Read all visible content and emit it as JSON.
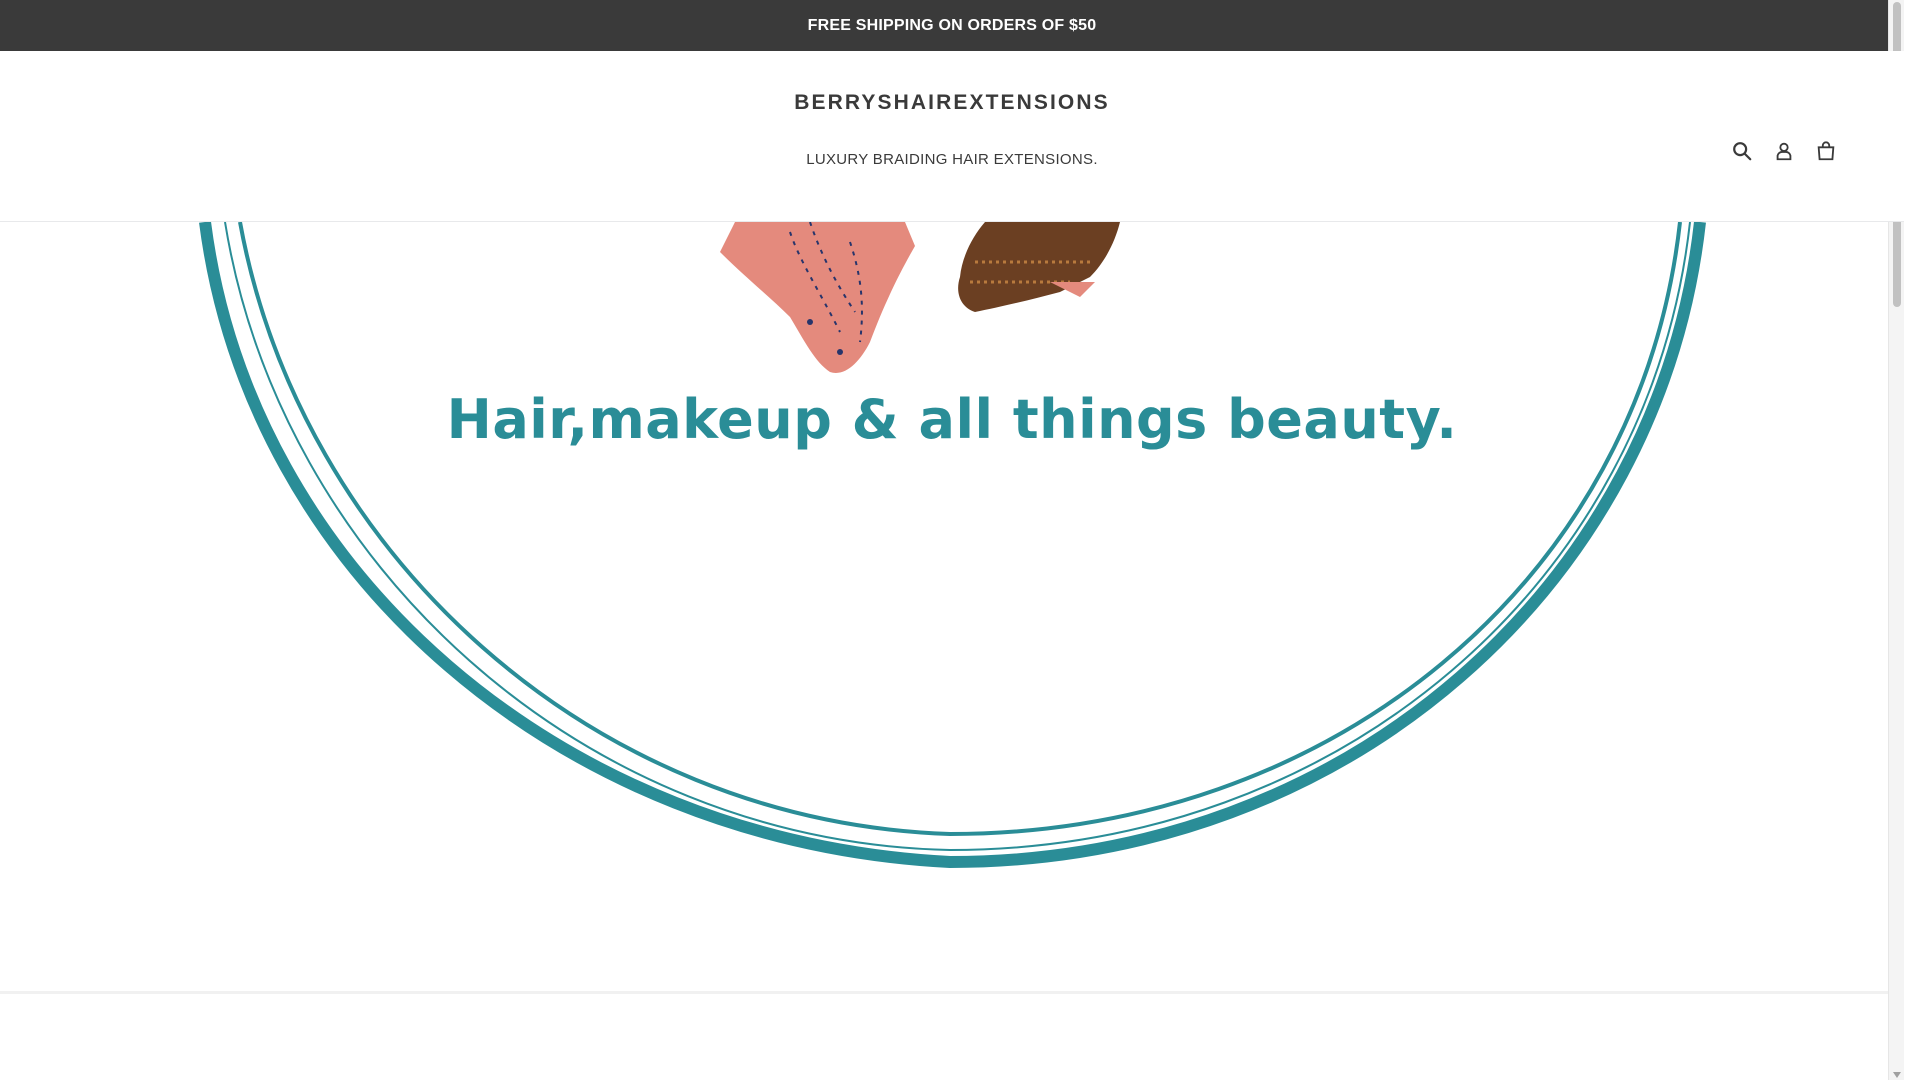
{
  "announcement": {
    "text": "FREE SHIPPING ON ORDERS OF $50"
  },
  "header": {
    "logo": "BERRYSHAIREXTENSIONS",
    "tagline": "LUXURY BRAIDING HAIR EXTENSIONS.",
    "icons": {
      "search": "search-icon",
      "account": "account-icon",
      "cart": "cart-icon"
    }
  },
  "hero": {
    "slogan": "Hair,makeup & all things beauty.",
    "accent_color": "#2a8d97"
  },
  "colors": {
    "announcement_bg": "#3a3a3a",
    "text": "#3a3a3a",
    "background": "#ffffff"
  }
}
